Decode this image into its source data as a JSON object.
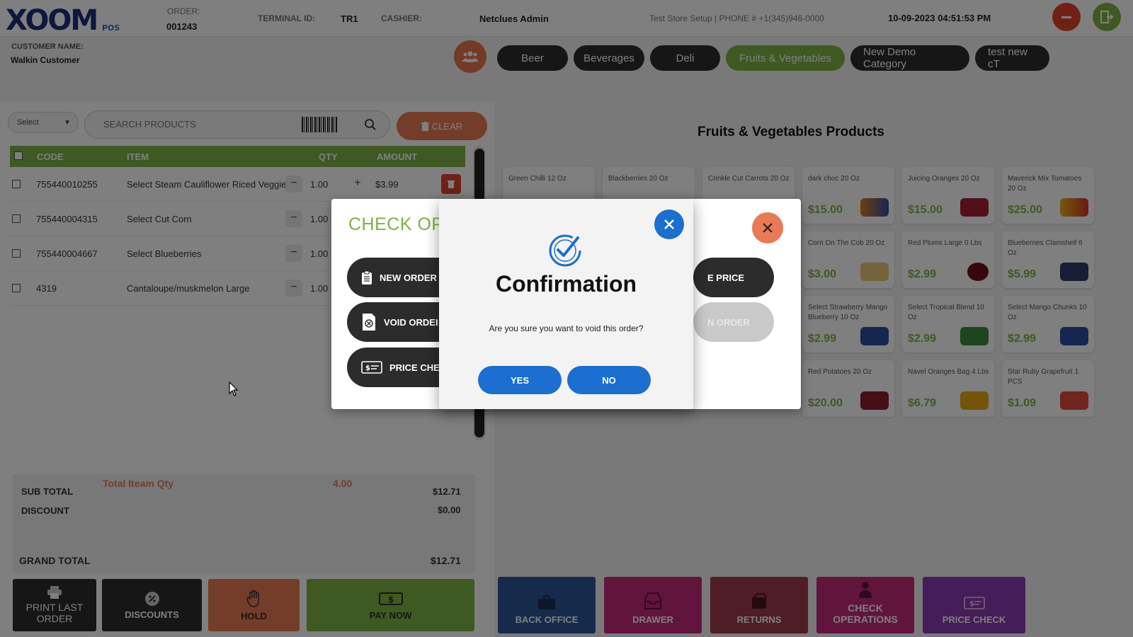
{
  "header": {
    "logo_text": "XOOM",
    "logo_sub": "POS",
    "order_label": "ORDER:",
    "order_value": "001243",
    "terminal_label": "TERMINAL ID:",
    "terminal_value": "TR1",
    "cashier_label": "CASHIER:",
    "cashier_value": "Netclues Admin",
    "store_info": "Test Store Setup | PHONE # +1(345)946-0000",
    "datetime": "10-09-2023 04:51:53 PM"
  },
  "customer": {
    "label": "CUSTOMER NAME:",
    "value": "Walkin Customer"
  },
  "categories": [
    {
      "label": "Beer",
      "active": false
    },
    {
      "label": "Beverages",
      "active": false
    },
    {
      "label": "Deli",
      "active": false
    },
    {
      "label": "Fruits & Vegetables",
      "active": true
    },
    {
      "label": "New Demo Category",
      "active": false
    },
    {
      "label": "test new cT",
      "active": false
    }
  ],
  "cart": {
    "select_label": "Select",
    "search_placeholder": "SEARCH PRODUCTS",
    "clear_label": "CLEAR",
    "columns": {
      "code": "CODE",
      "item": "ITEM",
      "qty": "QTY",
      "amount": "AMOUNT"
    },
    "rows": [
      {
        "code": "755440010255",
        "item": "Select Steam Cauliflower Riced Veggie",
        "qty": "1.00",
        "amount": "$3.99"
      },
      {
        "code": "755440004315",
        "item": "Select Cut Corn",
        "qty": "1.00",
        "amount": ""
      },
      {
        "code": "755440004667",
        "item": "Select Blueberries",
        "qty": "1.00",
        "amount": ""
      },
      {
        "code": "4319",
        "item": "Cantaloupe/muskmelon Large",
        "qty": "1.00",
        "amount": ""
      }
    ]
  },
  "totals": {
    "total_item_qty_label": "Total Iteam Qty",
    "total_item_qty_value": "4.00",
    "sub_total_label": "SUB TOTAL",
    "sub_total_value": "$12.71",
    "discount_label": "DISCOUNT",
    "discount_value": "$0.00",
    "grand_total_label": "GRAND TOTAL",
    "grand_total_value": "$12.71"
  },
  "bottom_actions": {
    "print_last_order": "PRINT LAST ORDER",
    "discounts": "DISCOUNTS",
    "hold": "HOLD",
    "pay_now": "PAY NOW"
  },
  "products_title": "Fruits & Vegetables Products",
  "products": [
    {
      "name": "Green Chilli 12 Oz",
      "price": ""
    },
    {
      "name": "Blackberries 20 Oz",
      "price": ""
    },
    {
      "name": "Crinkle Cut Carrots 20 Oz",
      "price": ""
    },
    {
      "name": "dark choc 20 Oz",
      "price": "$15.00"
    },
    {
      "name": "Juicing Oranges 20 Oz",
      "price": "$15.00"
    },
    {
      "name": "Maverick Mix Tomatoes 20 Oz",
      "price": "$25.00"
    },
    {
      "name": "Corn On The Cob 20 Oz",
      "price": "$3.00"
    },
    {
      "name": "Red Plums Large 0 Lbs",
      "price": "$2.99"
    },
    {
      "name": "Blueberries Clamshell 6 Oz",
      "price": "$5.99"
    },
    {
      "name": "Select Strawberry Mango Blueberry 10 Oz",
      "price": "$2.99"
    },
    {
      "name": "Select Tropical Blend 10 Oz",
      "price": "$2.99"
    },
    {
      "name": "Select Mango Chunks 10 Oz",
      "price": "$2.99"
    },
    {
      "name": "Red Potatoes 20 Oz",
      "price": "$20.00"
    },
    {
      "name": "Navel Oranges Bag 4 Lbs",
      "price": "$6.79"
    },
    {
      "name": "Star Ruby Grapefruit 1 PCS",
      "price": "$1.09"
    }
  ],
  "right_actions": {
    "back_office": "BACK OFFICE",
    "drawer": "DRAWER",
    "returns": "RETURNS",
    "check_operations": "CHECK OPERATIONS",
    "price_check": "PRICE CHECK"
  },
  "check_ops_dialog": {
    "title": "CHECK OPE",
    "new_order": "NEW ORDER",
    "void_order": "VOID ORDEI",
    "price_check": "PRICE CHEC",
    "change_price": "E PRICE",
    "open_order": "N ORDER"
  },
  "confirm_dialog": {
    "title": "Confirmation",
    "message": "Are you sure you want to void this order?",
    "yes": "YES",
    "no": "NO"
  },
  "colors": {
    "accent_green": "#7cb242",
    "accent_orange": "#e97a55",
    "accent_blue": "#1a6fd0",
    "dark": "#2c2c2c",
    "back_office": "#2d5599",
    "drawer": "#c42b78",
    "returns": "#9c3b4d",
    "check_operations": "#c42b78",
    "price_check": "#8a3ab0"
  }
}
